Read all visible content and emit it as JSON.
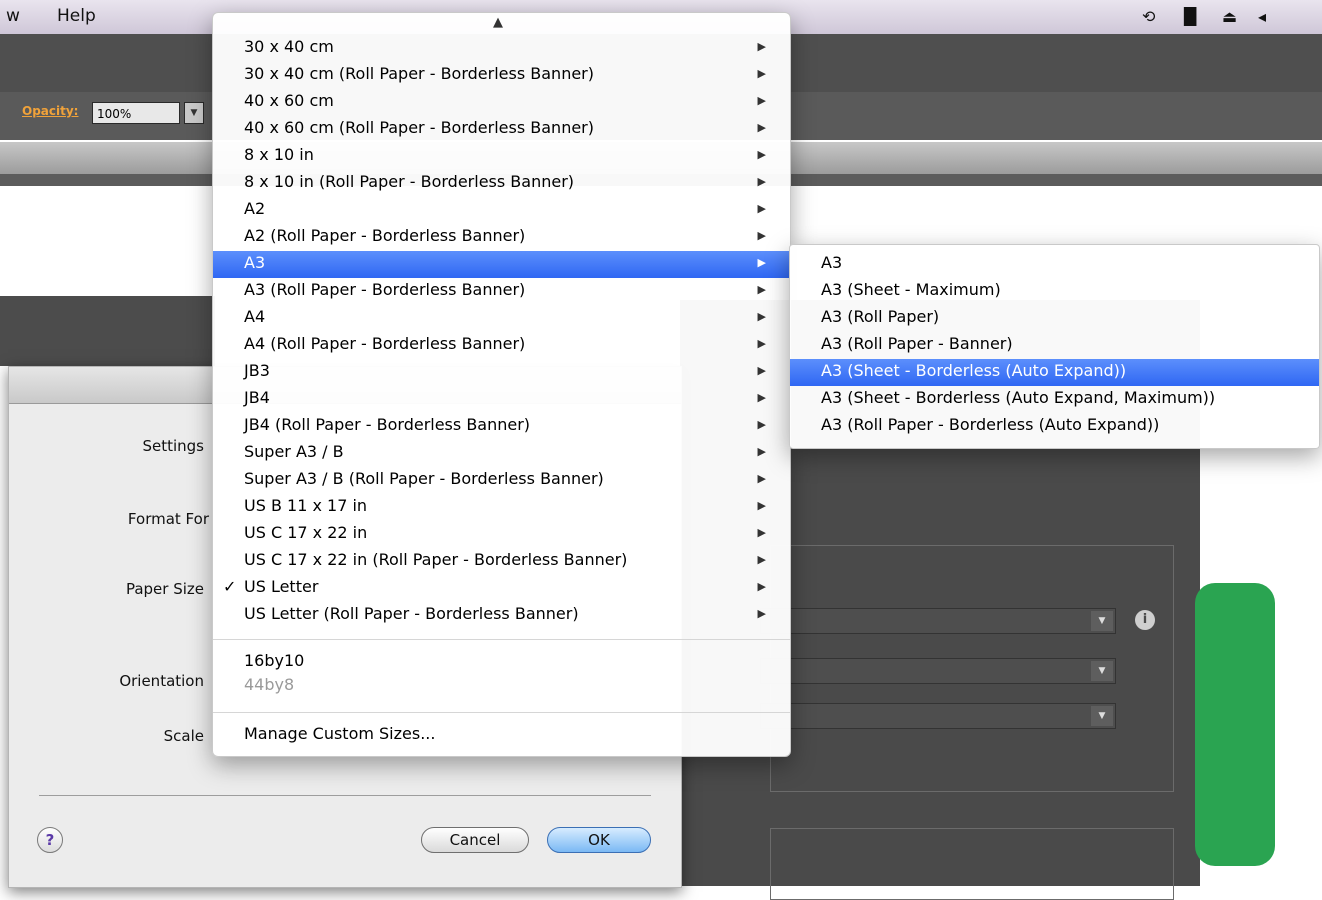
{
  "menubar": {
    "items": [
      "w",
      "Help"
    ],
    "icons": [
      "time-machine-icon",
      "binoculars-icon",
      "eject-icon",
      "volume-icon"
    ]
  },
  "control_bar": {
    "opacity_label": "Opacity:",
    "opacity_value": "100%"
  },
  "page_setup": {
    "labels": {
      "settings": "Settings",
      "format_for": "Format For",
      "paper_size": "Paper Size",
      "orientation": "Orientation",
      "scale": "Scale"
    },
    "help_label": "?",
    "cancel_label": "Cancel",
    "ok_label": "OK"
  },
  "print_panel": {
    "info_label": "i"
  },
  "paper_menu": {
    "items": [
      "30 x 40 cm",
      "30 x 40 cm (Roll Paper - Borderless Banner)",
      "40 x 60 cm",
      "40 x 60 cm (Roll Paper - Borderless Banner)",
      "8 x 10 in",
      "8 x 10 in (Roll Paper - Borderless Banner)",
      "A2",
      "A2 (Roll Paper - Borderless Banner)",
      "A3",
      "A3 (Roll Paper - Borderless Banner)",
      "A4",
      "A4 (Roll Paper - Borderless Banner)",
      "JB3",
      "JB4",
      "JB4 (Roll Paper - Borderless Banner)",
      "Super A3 / B",
      "Super A3 / B (Roll Paper - Borderless Banner)",
      "US B 11 x 17 in",
      "US C 17 x 22 in",
      "US C 17 x 22 in (Roll Paper - Borderless Banner)",
      "US Letter",
      "US Letter (Roll Paper - Borderless Banner)"
    ],
    "highlighted_item": "A3",
    "checked_item": "US Letter",
    "custom_sizes": [
      "16by10",
      "44by8"
    ],
    "disabled_custom_size": "44by8",
    "manage_label": "Manage Custom Sizes..."
  },
  "a3_submenu": {
    "items": [
      "A3",
      "A3 (Sheet - Maximum)",
      "A3 (Roll Paper)",
      "A3 (Roll Paper - Banner)",
      "A3 (Sheet - Borderless (Auto Expand))",
      "A3 (Sheet - Borderless (Auto Expand, Maximum))",
      "A3 (Roll Paper - Borderless (Auto Expand))"
    ],
    "highlighted_item": "A3 (Sheet - Borderless (Auto Expand))"
  },
  "colors": {
    "highlight": "#2f67f3",
    "accent_green": "#2aa451",
    "opacity_label": "#f0a23a"
  }
}
